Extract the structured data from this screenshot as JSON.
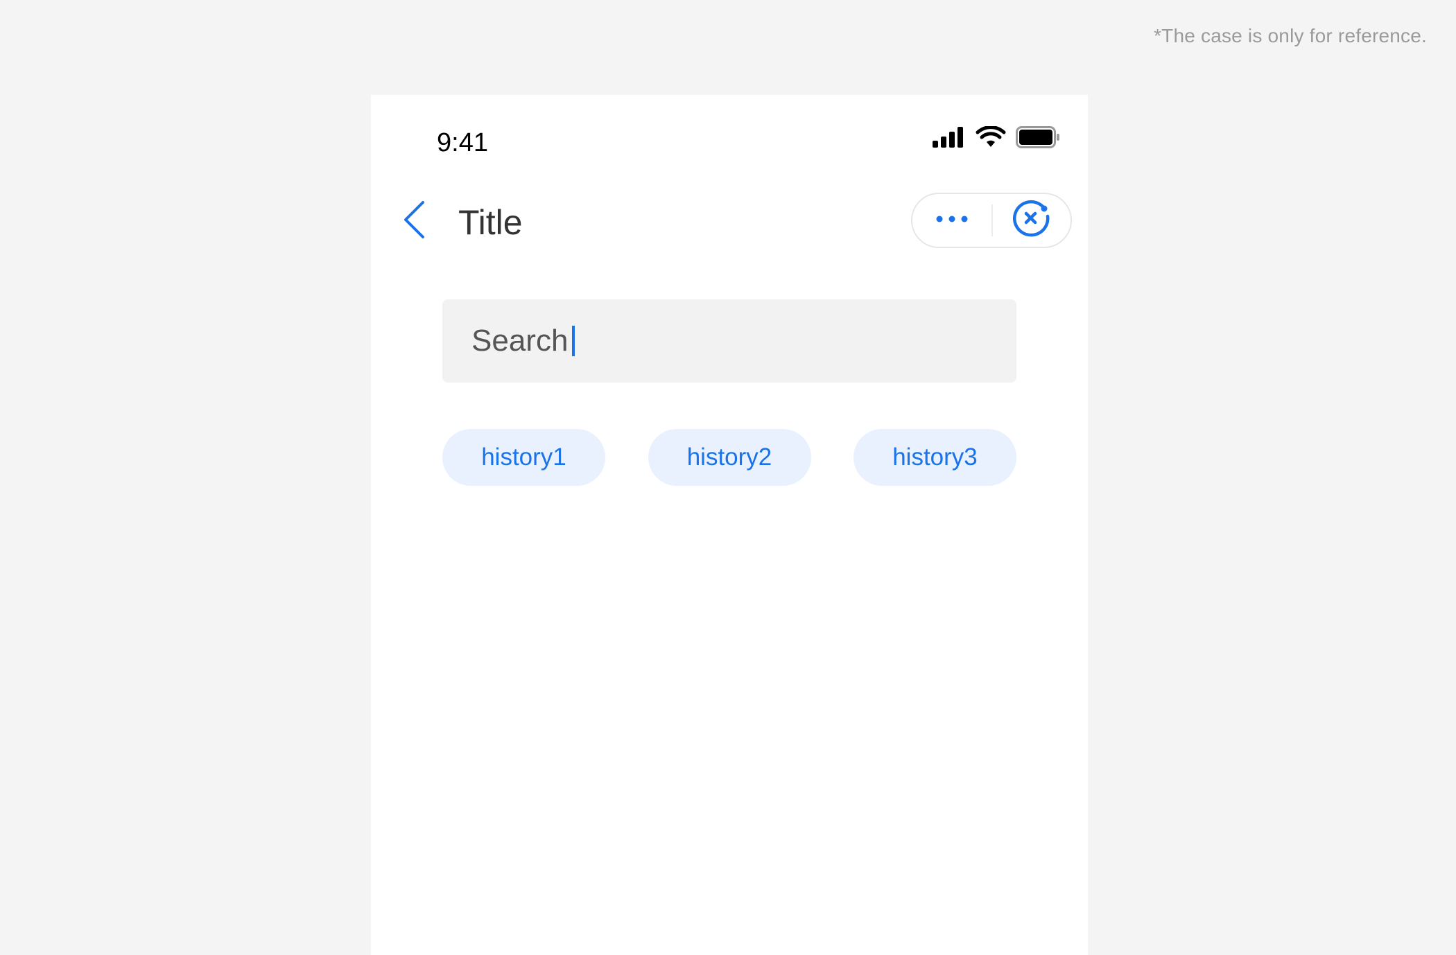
{
  "note": "*The case is only for reference.",
  "status_bar": {
    "time": "9:41",
    "icons": [
      "signal-icon",
      "wifi-icon",
      "battery-icon"
    ]
  },
  "nav": {
    "title": "Title",
    "back_icon": "chevron-left-icon",
    "more_icon": "more-dots-icon",
    "close_icon": "close-circle-icon"
  },
  "search": {
    "placeholder": "Search"
  },
  "history": [
    {
      "label": "history1"
    },
    {
      "label": "history2"
    },
    {
      "label": "history3"
    }
  ],
  "colors": {
    "accent": "#1a73e8",
    "chip_bg": "#e8f1fd",
    "search_bg": "#f2f2f2",
    "outer_bg": "#f4f4f4"
  }
}
